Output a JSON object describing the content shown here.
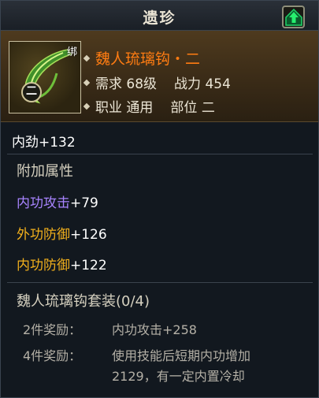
{
  "header": {
    "title": "遗珍",
    "badge_icon": "green-up-arrow-icon"
  },
  "item": {
    "bind_label": "绑",
    "name": "魏人琉璃钩・二",
    "req_label": "需求",
    "req_value": "68级",
    "power_label": "战力",
    "power_value": "454",
    "job_label": "职业",
    "job_value": "通用",
    "slot_label": "部位",
    "slot_value": "二",
    "icon": "hook-weapon-icon",
    "icon_glyph": "二"
  },
  "base_stat": "内劲+132",
  "extra": {
    "title": "附加属性",
    "attrs": [
      {
        "name": "内功攻击",
        "value": "+79"
      },
      {
        "name": "外功防御",
        "value": "+126"
      },
      {
        "name": "内功防御",
        "value": "+122"
      }
    ]
  },
  "set": {
    "title": "魏人琉璃钩套装(0/4)",
    "bonuses": [
      {
        "label": "2件奖励：",
        "desc": [
          "内功攻击+258"
        ]
      },
      {
        "label": "4件奖励：",
        "desc": [
          "使用技能后短期内功增加",
          "2129，有一定内置冷却"
        ]
      }
    ]
  },
  "colors": {
    "orange_name": "#ff7c12",
    "purple_attr": "#a884ff",
    "gold_attr": "#f2b01c",
    "badge_green": "#1fd36a"
  }
}
